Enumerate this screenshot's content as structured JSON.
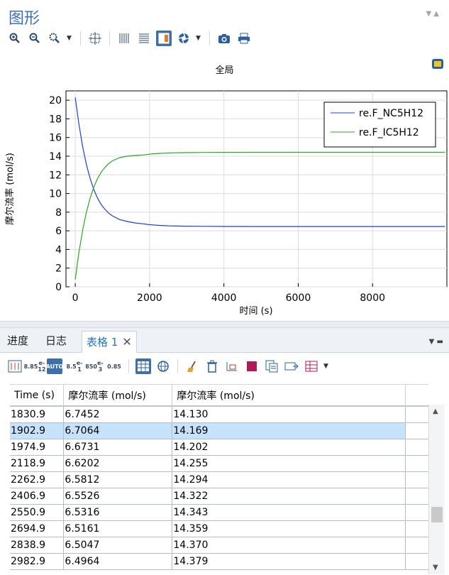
{
  "window": {
    "title": "图形"
  },
  "plot": {
    "label": "全局",
    "xlabel": "时间 (s)",
    "ylabel": "摩尔流率 (mol/s)",
    "xticks": [
      "0",
      "2000",
      "4000",
      "6000",
      "8000"
    ],
    "yticks": [
      "0",
      "2",
      "4",
      "6",
      "8",
      "10",
      "12",
      "14",
      "16",
      "18",
      "20"
    ],
    "legend": [
      "re.F_NC5H12",
      "re.F_IC5H12"
    ]
  },
  "chart_data": {
    "type": "line",
    "xlabel": "时间 (s)",
    "ylabel": "摩尔流率 (mol/s)",
    "xlim": [
      -250,
      10000
    ],
    "ylim": [
      0,
      21
    ],
    "grid": true,
    "legend_position": "top-right",
    "series": [
      {
        "name": "re.F_NC5H12",
        "color": "#1f3fd6",
        "x": [
          0,
          100,
          200,
          300,
          400,
          500,
          600,
          700,
          800,
          900,
          1000,
          1200,
          1400,
          1600,
          1830.9,
          1902.9,
          1974.9,
          2118.9,
          2262.9,
          2406.9,
          2550.9,
          2694.9,
          2838.9,
          2982.9,
          3500,
          4000,
          5000,
          6000,
          7000,
          8000,
          9000,
          9950
        ],
        "y": [
          20.3,
          17.4,
          15.0,
          13.1,
          11.6,
          10.4,
          9.5,
          8.8,
          8.3,
          7.9,
          7.6,
          7.2,
          7.0,
          6.85,
          6.7452,
          6.7064,
          6.6731,
          6.6202,
          6.5812,
          6.5526,
          6.5316,
          6.5161,
          6.5047,
          6.4964,
          6.48,
          6.47,
          6.46,
          6.46,
          6.46,
          6.46,
          6.46,
          6.46
        ]
      },
      {
        "name": "re.F_IC5H12",
        "color": "#2aa52a",
        "x": [
          0,
          100,
          200,
          300,
          400,
          500,
          600,
          700,
          800,
          900,
          1000,
          1200,
          1400,
          1600,
          1830.9,
          1902.9,
          1974.9,
          2118.9,
          2262.9,
          2406.9,
          2550.9,
          2694.9,
          2838.9,
          2982.9,
          3500,
          4000,
          5000,
          6000,
          7000,
          8000,
          9000,
          9950
        ],
        "y": [
          0.8,
          3.7,
          6.1,
          8.0,
          9.5,
          10.7,
          11.6,
          12.3,
          12.8,
          13.2,
          13.5,
          13.85,
          14.0,
          14.07,
          14.13,
          14.169,
          14.202,
          14.255,
          14.294,
          14.322,
          14.343,
          14.359,
          14.37,
          14.379,
          14.4,
          14.41,
          14.42,
          14.42,
          14.42,
          14.42,
          14.42,
          14.42
        ]
      }
    ]
  },
  "bottom": {
    "tabs": [
      "进度",
      "日志",
      "表格 1"
    ],
    "active_tab": "表格 1"
  },
  "table": {
    "headers": [
      "Time (s)",
      "摩尔流率 (mol/s)",
      "摩尔流率 (mol/s)"
    ],
    "rows": [
      [
        "1830.9",
        "6.7452",
        "14.130"
      ],
      [
        "1902.9",
        "6.7064",
        "14.169"
      ],
      [
        "1974.9",
        "6.6731",
        "14.202"
      ],
      [
        "2118.9",
        "6.6202",
        "14.255"
      ],
      [
        "2262.9",
        "6.5812",
        "14.294"
      ],
      [
        "2406.9",
        "6.5526",
        "14.322"
      ],
      [
        "2550.9",
        "6.5316",
        "14.343"
      ],
      [
        "2694.9",
        "6.5161",
        "14.359"
      ],
      [
        "2838.9",
        "6.5047",
        "14.370"
      ],
      [
        "2982.9",
        "6.4964",
        "14.379"
      ]
    ],
    "selected_row": 1
  },
  "format_buttons": [
    {
      "top": "8.85",
      "bottom": "e-12"
    },
    {
      "top": "AUTO",
      "bottom": ""
    },
    {
      "top": "8.5",
      "bottom": "e-1"
    },
    {
      "top": "850",
      "bottom": "e-3"
    },
    {
      "top": "0.85",
      "bottom": ""
    }
  ],
  "colors": {
    "accent": "#3c6fb4",
    "selection": "#c7e3fb",
    "active_tab_text": "#2b74c4"
  }
}
